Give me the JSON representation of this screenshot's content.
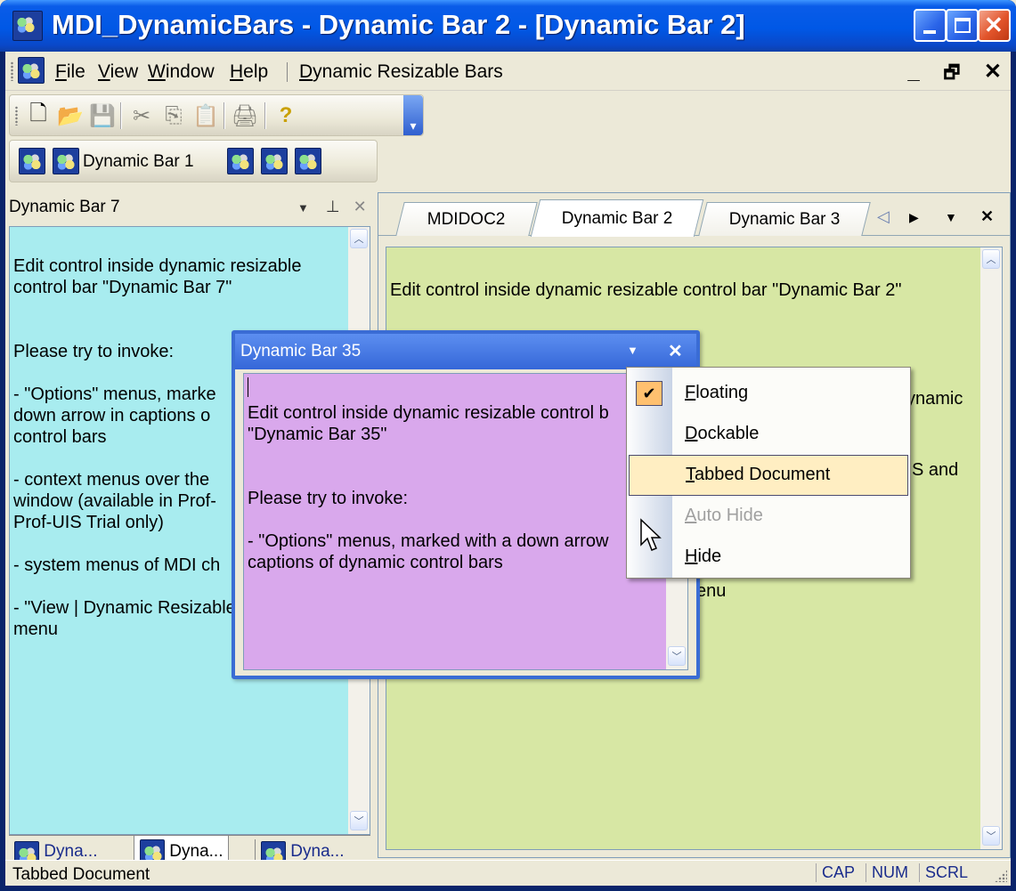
{
  "window": {
    "title": "MDI_DynamicBars - Dynamic Bar 2 - [Dynamic Bar 2]"
  },
  "menu": {
    "items": [
      {
        "label": "File",
        "key": "F",
        "rest": "ile"
      },
      {
        "label": "View",
        "key": "V",
        "rest": "iew"
      },
      {
        "label": "Window",
        "key": "W",
        "rest": "indow"
      },
      {
        "label": "Help",
        "key": "H",
        "rest": "elp"
      },
      {
        "label": "Dynamic Resizable Bars",
        "key": "D",
        "rest": "ynamic Resizable Bars"
      }
    ],
    "mdi_minimize": "_",
    "mdi_restore": "🗗",
    "mdi_close": "✕"
  },
  "toolbar": {
    "new": "🗋",
    "open": "📂",
    "save": "💾",
    "cut": "✂",
    "copy": "⎘",
    "paste": "📋",
    "print": "🖨",
    "help": "?",
    "more": "▾"
  },
  "dynbar_toolbar": {
    "button_label": "Dynamic Bar 1"
  },
  "bar7": {
    "title": "Dynamic Bar 7",
    "icons": {
      "options": "▼",
      "pin": "⊥",
      "close": "✕"
    },
    "lines": [
      "Edit control inside dynamic resizable",
      "control bar \"Dynamic Bar 7\"",
      "",
      "",
      "Please try to invoke:",
      "",
      "- \"Options\" menus, marke",
      "down arrow in captions o",
      "control bars",
      "",
      "- context menus over the",
      "window (available in Prof-",
      "Prof-UIS Trial only)",
      "",
      "- system menus of MDI ch",
      "",
      "- \"View | Dynamic Resizable Bars\"",
      "menu"
    ],
    "tabs": [
      "Dyna...",
      "Dyna...",
      "Dyna..."
    ]
  },
  "tabbed": {
    "tabs": [
      "MDIDOC2",
      "Dynamic Bar 2",
      "Dynamic Bar 3"
    ],
    "active_tab": "Dynamic Bar 2",
    "nav": {
      "prev": "◁",
      "next": "▶",
      "list": "▼",
      "close": "✕"
    },
    "lines": [
      "Edit control inside dynamic resizable control bar \"Dynamic Bar 2\""
    ],
    "fragments": [
      "ynamic",
      "S and",
      "enu"
    ]
  },
  "bar35": {
    "title": "Dynamic Bar 35",
    "icons": {
      "options": "▼",
      "close": "✕"
    },
    "lines": [
      "Edit control inside dynamic resizable control b",
      "\"Dynamic Bar 35\"",
      "",
      "",
      "Please try to invoke:",
      "",
      "- \"Options\" menus, marked with a down arrow",
      "captions of dynamic control bars"
    ]
  },
  "context_menu": {
    "items": [
      {
        "label": "Floating",
        "key": "F",
        "rest": "loating",
        "checked": true,
        "enabled": true,
        "highlighted": false
      },
      {
        "label": "Dockable",
        "key": "D",
        "rest": "ockable",
        "checked": false,
        "enabled": true,
        "highlighted": false
      },
      {
        "label": "Tabbed Document",
        "key": "T",
        "rest": "abbed Document",
        "checked": false,
        "enabled": true,
        "highlighted": true
      },
      {
        "label": "Auto Hide",
        "key": "A",
        "rest": "uto Hide",
        "checked": false,
        "enabled": false,
        "highlighted": false
      },
      {
        "label": "Hide",
        "key": "H",
        "rest": "ide",
        "checked": false,
        "enabled": true,
        "highlighted": false
      }
    ]
  },
  "status": {
    "text": "Tabbed Document",
    "panes": [
      "CAP",
      "NUM",
      "SCRL"
    ]
  },
  "colors": {
    "bar7_bg": "#a8ecef",
    "bar2_bg": "#d7e7a4",
    "bar35_bg": "#d9a8ec",
    "titlebar": "#0058e6"
  }
}
